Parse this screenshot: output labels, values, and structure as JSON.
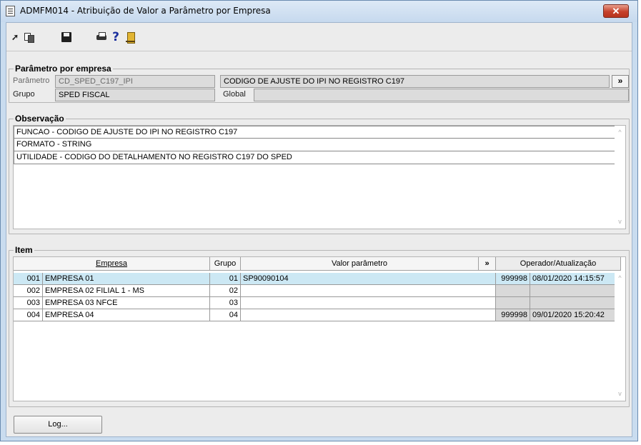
{
  "window": {
    "title": "ADMFM014 - Atribuição de Valor a Parâmetro por Empresa",
    "close_glyph": "✕"
  },
  "toolbar": {
    "icons": [
      "arrow-icon",
      "copy-icon",
      "save-icon",
      "print-icon",
      "help-icon",
      "exit-icon"
    ],
    "arrow_glyph": "➚",
    "help_glyph": "?"
  },
  "parametro_section": {
    "legend": "Parâmetro por empresa",
    "parametro_label": "Parâmetro",
    "parametro_code": "CD_SPED_C197_IPI",
    "parametro_desc": "CODIGO DE AJUSTE DO IPI NO REGISTRO C197",
    "more_glyph": "»",
    "grupo_label": "Grupo",
    "grupo_value": "SPED FISCAL",
    "global_label": "Global",
    "global_value": ""
  },
  "observacao": {
    "legend": "Observação",
    "lines": [
      "FUNCAO - CODIGO DE AJUSTE DO IPI NO REGISTRO C197",
      "FORMATO - STRING",
      "UTILIDADE - CODIGO DO DETALHAMENTO NO REGISTRO C197 DO SPED"
    ]
  },
  "item": {
    "legend": "Item",
    "headers": {
      "empresa": "Empresa",
      "grupo": "Grupo",
      "valor": "Valor parâmetro",
      "more": "»",
      "operador": "Operador/Atualização"
    },
    "rows": [
      {
        "cod": "001",
        "nome": "EMPRESA 01",
        "grupo": "01",
        "valor": "SP90090104",
        "operador": "999998",
        "data": "08/01/2020 14:15:57"
      },
      {
        "cod": "002",
        "nome": "EMPRESA 02 FILIAL 1 - MS",
        "grupo": "02",
        "valor": "",
        "operador": "",
        "data": ""
      },
      {
        "cod": "003",
        "nome": "EMPRESA 03 NFCE",
        "grupo": "03",
        "valor": "",
        "operador": "",
        "data": ""
      },
      {
        "cod": "004",
        "nome": "EMPRESA 04",
        "grupo": "04",
        "valor": "",
        "operador": "999998",
        "data": "09/01/2020 15:20:42"
      }
    ]
  },
  "footer": {
    "log_button": "Log..."
  },
  "scroll": {
    "up_glyph": "^",
    "down_glyph": "v"
  }
}
